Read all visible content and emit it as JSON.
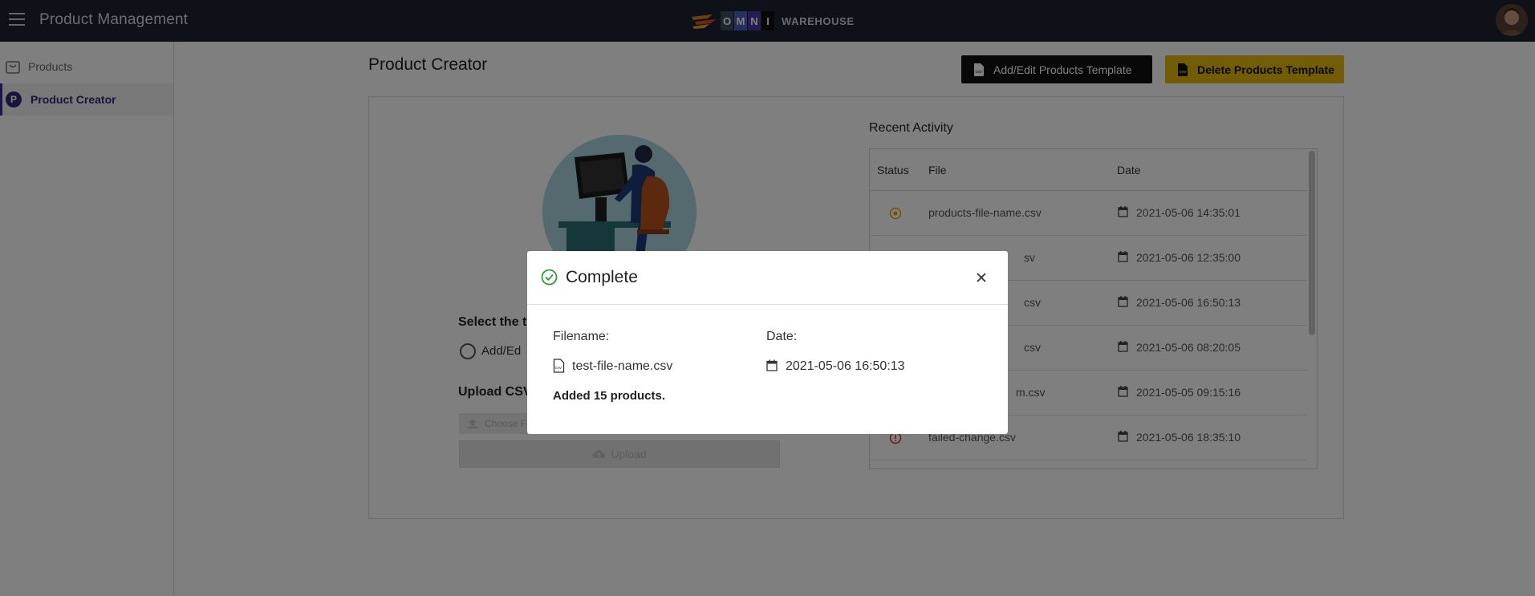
{
  "header": {
    "app_title": "Product Management",
    "logo_letters": [
      "O",
      "M",
      "N",
      "I"
    ],
    "logo_word": "WAREHOUSE",
    "colors": {
      "bar": "#1c2331",
      "logo_o": "#3d4d63",
      "logo_m": "#4a5fc1",
      "logo_n": "#4a3a9c",
      "logo_i": "#111111"
    }
  },
  "sidebar": {
    "items": [
      {
        "label": "Products",
        "icon": "shopping-bag-icon",
        "active": false
      },
      {
        "label": "Product Creator",
        "icon": "p-circle-icon",
        "badge": "P",
        "active": true
      }
    ]
  },
  "main": {
    "page_title": "Product Creator",
    "buttons": {
      "add_edit": "Add/Edit Products Template",
      "delete": "Delete Products Template"
    },
    "form": {
      "select_label": "Select the t",
      "radio_label": "Add/Ed",
      "upload_label": "Upload CSV",
      "file_placeholder": "Choose F",
      "upload_button": "Upload"
    },
    "recent": {
      "title": "Recent Activity",
      "columns": [
        "Status",
        "File",
        "Date"
      ],
      "rows": [
        {
          "status": "pending",
          "file": "products-file-name.csv",
          "date": "2021-05-06 14:35:01"
        },
        {
          "status": "error",
          "file": "sv",
          "date": "2021-05-06 12:35:00"
        },
        {
          "status": "success",
          "file": "csv",
          "date": "2021-05-06 16:50:13"
        },
        {
          "status": "success",
          "file": "csv",
          "date": "2021-05-06 08:20:05"
        },
        {
          "status": "success",
          "file": "m.csv",
          "date": "2021-05-05 09:15:16"
        },
        {
          "status": "error",
          "file": "failed-change.csv",
          "date": "2021-05-06 18:35:10"
        }
      ]
    },
    "colors": {
      "delete_button": "#e4b80c",
      "add_button": "#111111",
      "pending": "#e0a800",
      "error": "#d32f2f"
    }
  },
  "dialog": {
    "title": "Complete",
    "filename_label": "Filename:",
    "filename_value": "test-file-name.csv",
    "date_label": "Date:",
    "date_value": "2021-05-06 16:50:13",
    "message": "Added 15 products.",
    "colors": {
      "success": "#2e9b3a"
    }
  }
}
